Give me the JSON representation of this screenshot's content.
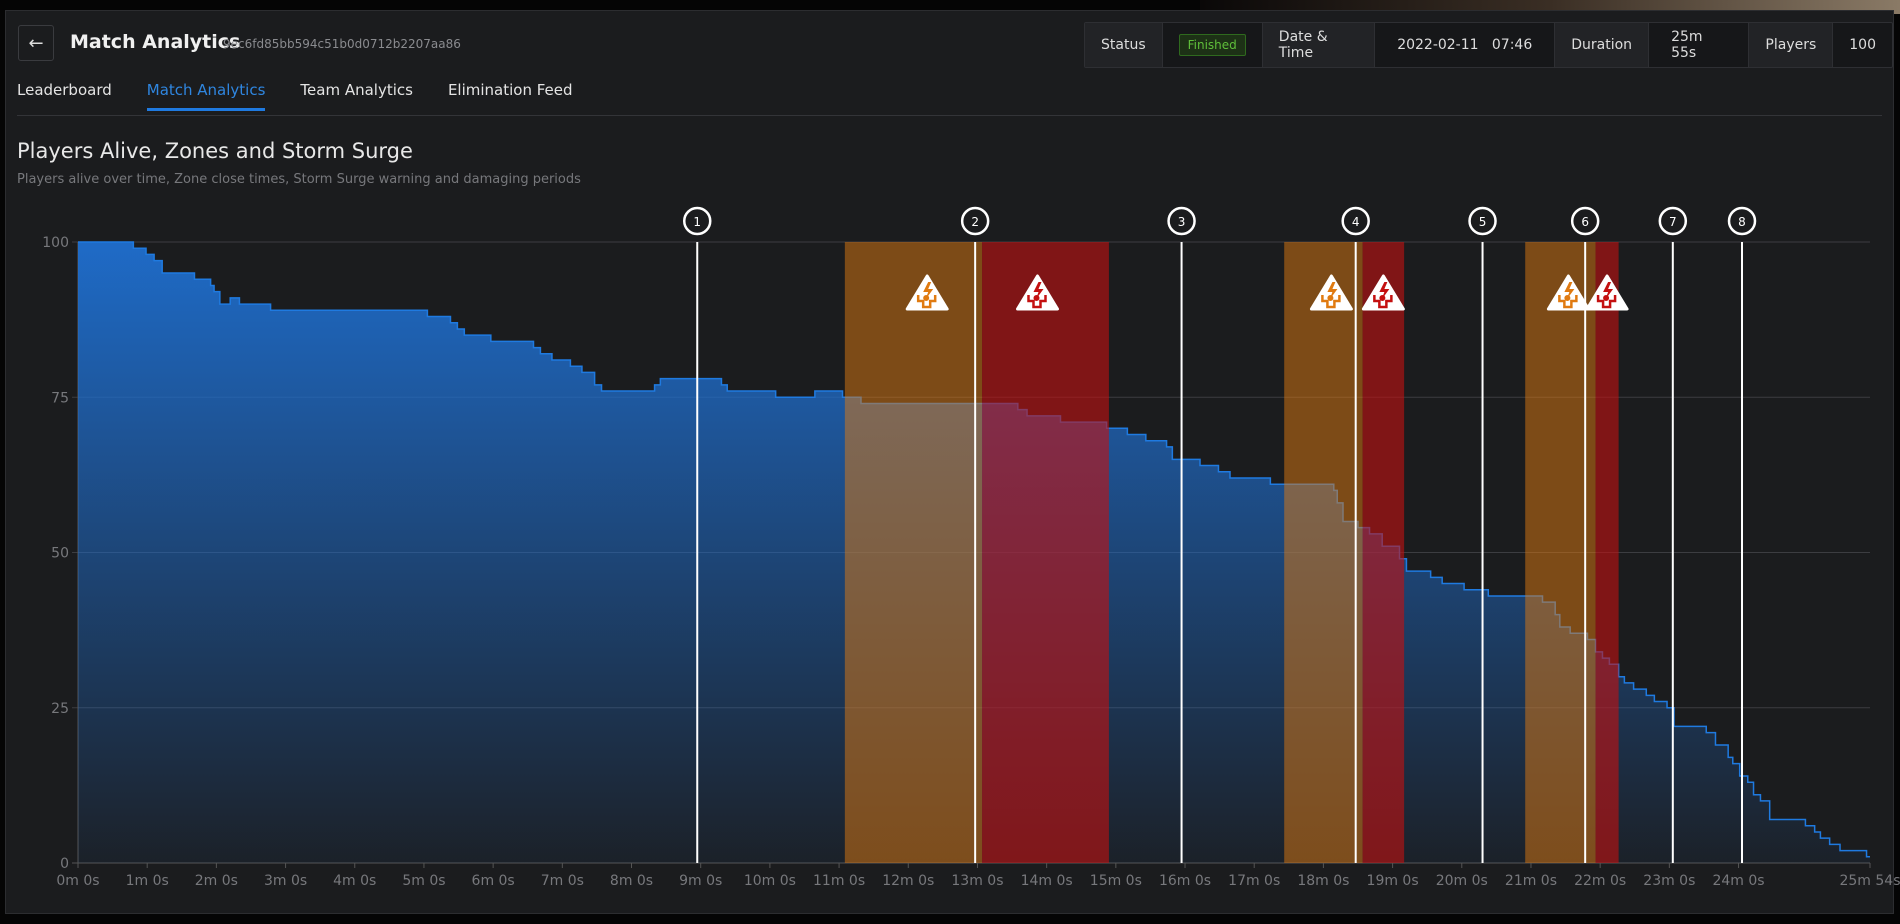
{
  "header": {
    "back_icon": "arrow-left-icon",
    "title": "Match Analytics",
    "match_id": "9ec6fd85bb594c51b0d0712b2207aa86",
    "stats": [
      {
        "label": "Status",
        "value": "Finished",
        "badge": true
      },
      {
        "label": "Date & Time",
        "value": "2022-02-11   07:46"
      },
      {
        "label": "Duration",
        "value": "25m 55s"
      },
      {
        "label": "Players",
        "value": "100"
      }
    ],
    "status_color": "#5fbf3a"
  },
  "tabs": [
    {
      "label": "Leaderboard"
    },
    {
      "label": "Match Analytics",
      "active": true
    },
    {
      "label": "Team Analytics"
    },
    {
      "label": "Elimination Feed"
    }
  ],
  "accent_color": "#1f7ae0",
  "chart_data": {
    "type": "area",
    "title": "Players Alive, Zones and Storm Surge",
    "subtitle": "Players alive over time, Zone close times, Storm Surge warning and damaging periods",
    "x_unit": "seconds",
    "xlim": [
      0,
      1554
    ],
    "ylim": [
      0,
      100
    ],
    "yticks": [
      0,
      25,
      50,
      75,
      100
    ],
    "xticks": [
      {
        "t": 0,
        "label": "0m 0s"
      },
      {
        "t": 60,
        "label": "1m 0s"
      },
      {
        "t": 120,
        "label": "2m 0s"
      },
      {
        "t": 180,
        "label": "3m 0s"
      },
      {
        "t": 240,
        "label": "4m 0s"
      },
      {
        "t": 300,
        "label": "5m 0s"
      },
      {
        "t": 360,
        "label": "6m 0s"
      },
      {
        "t": 420,
        "label": "7m 0s"
      },
      {
        "t": 480,
        "label": "8m 0s"
      },
      {
        "t": 540,
        "label": "9m 0s"
      },
      {
        "t": 600,
        "label": "10m 0s"
      },
      {
        "t": 660,
        "label": "11m 0s"
      },
      {
        "t": 720,
        "label": "12m 0s"
      },
      {
        "t": 780,
        "label": "13m 0s"
      },
      {
        "t": 840,
        "label": "14m 0s"
      },
      {
        "t": 900,
        "label": "15m 0s"
      },
      {
        "t": 960,
        "label": "16m 0s"
      },
      {
        "t": 1020,
        "label": "17m 0s"
      },
      {
        "t": 1080,
        "label": "18m 0s"
      },
      {
        "t": 1140,
        "label": "19m 0s"
      },
      {
        "t": 1200,
        "label": "20m 0s"
      },
      {
        "t": 1260,
        "label": "21m 0s"
      },
      {
        "t": 1320,
        "label": "22m 0s"
      },
      {
        "t": 1380,
        "label": "23m 0s"
      },
      {
        "t": 1440,
        "label": "24m 0s"
      },
      {
        "t": 1554,
        "label": "25m 54s"
      }
    ],
    "grid": true,
    "series_color": "#1f6fd0",
    "players_alive": [
      [
        0,
        100
      ],
      [
        48,
        99
      ],
      [
        59,
        98
      ],
      [
        66,
        97
      ],
      [
        73,
        95
      ],
      [
        101,
        94
      ],
      [
        115,
        93
      ],
      [
        118,
        92
      ],
      [
        123,
        90
      ],
      [
        132,
        91
      ],
      [
        140,
        90
      ],
      [
        167,
        89
      ],
      [
        303,
        88
      ],
      [
        323,
        87
      ],
      [
        329,
        86
      ],
      [
        335,
        85
      ],
      [
        358,
        84
      ],
      [
        395,
        83
      ],
      [
        401,
        82
      ],
      [
        411,
        81
      ],
      [
        427,
        80
      ],
      [
        437,
        79
      ],
      [
        448,
        77
      ],
      [
        454,
        76
      ],
      [
        500,
        77
      ],
      [
        505,
        78
      ],
      [
        558,
        77
      ],
      [
        563,
        76
      ],
      [
        605,
        75
      ],
      [
        639,
        76
      ],
      [
        663,
        75
      ],
      [
        679,
        74
      ],
      [
        815,
        73
      ],
      [
        823,
        72
      ],
      [
        852,
        71
      ],
      [
        892,
        70
      ],
      [
        910,
        69
      ],
      [
        926,
        68
      ],
      [
        944,
        67
      ],
      [
        949,
        65
      ],
      [
        973,
        64
      ],
      [
        989,
        63
      ],
      [
        999,
        62
      ],
      [
        1034,
        61
      ],
      [
        1089,
        60
      ],
      [
        1092,
        58
      ],
      [
        1097,
        55
      ],
      [
        1110,
        54
      ],
      [
        1120,
        53
      ],
      [
        1131,
        51
      ],
      [
        1146,
        49
      ],
      [
        1152,
        47
      ],
      [
        1173,
        46
      ],
      [
        1183,
        45
      ],
      [
        1202,
        44
      ],
      [
        1223,
        43
      ],
      [
        1270,
        42
      ],
      [
        1281,
        40
      ],
      [
        1285,
        38
      ],
      [
        1294,
        37
      ],
      [
        1309,
        36
      ],
      [
        1316,
        34
      ],
      [
        1322,
        33
      ],
      [
        1328,
        32
      ],
      [
        1336,
        30
      ],
      [
        1341,
        29
      ],
      [
        1349,
        28
      ],
      [
        1360,
        27
      ],
      [
        1367,
        26
      ],
      [
        1378,
        25
      ],
      [
        1384,
        22
      ],
      [
        1412,
        21
      ],
      [
        1420,
        19
      ],
      [
        1431,
        17
      ],
      [
        1435,
        16
      ],
      [
        1441,
        14
      ],
      [
        1448,
        13
      ],
      [
        1453,
        11
      ],
      [
        1459,
        10
      ],
      [
        1467,
        7
      ],
      [
        1498,
        6
      ],
      [
        1506,
        5
      ],
      [
        1511,
        4
      ],
      [
        1519,
        3
      ],
      [
        1528,
        2
      ],
      [
        1551,
        1
      ],
      [
        1554,
        1
      ]
    ],
    "zones": [
      {
        "label": "1",
        "t": 537
      },
      {
        "label": "2",
        "t": 778
      },
      {
        "label": "3",
        "t": 957
      },
      {
        "label": "4",
        "t": 1108
      },
      {
        "label": "5",
        "t": 1218
      },
      {
        "label": "6",
        "t": 1307
      },
      {
        "label": "7",
        "t": 1383
      },
      {
        "label": "8",
        "t": 1443
      }
    ],
    "storm_surge": [
      {
        "warning": [
          665,
          784
        ],
        "damaging": [
          784,
          894
        ]
      },
      {
        "warning": [
          1046,
          1114
        ],
        "damaging": [
          1114,
          1150
        ]
      },
      {
        "warning": [
          1255,
          1316
        ],
        "damaging": [
          1316,
          1336
        ]
      }
    ],
    "warning_color": "#e07a10",
    "damaging_color": "#c41010",
    "storm_icon": "storm-surge-warning-icon"
  }
}
